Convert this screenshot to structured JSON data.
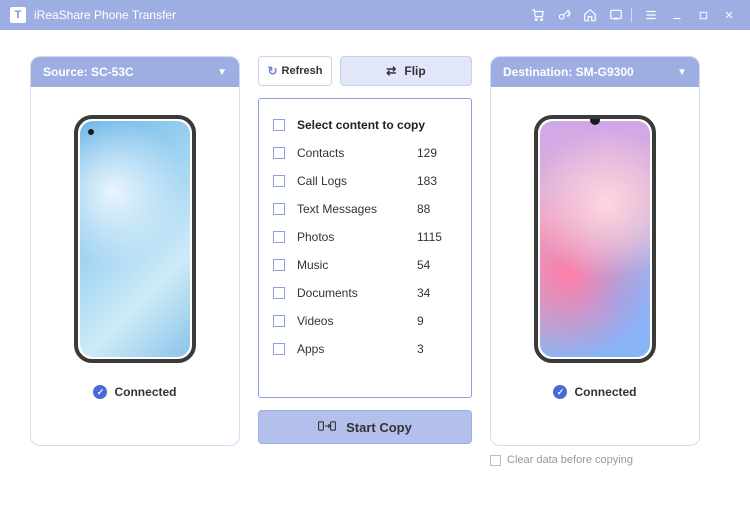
{
  "titlebar": {
    "logo": "T",
    "title": "iReaShare Phone Transfer"
  },
  "source": {
    "header_prefix": "Source: ",
    "device_name": "SC-53C",
    "status": "Connected"
  },
  "destination": {
    "header_prefix": "Destination: ",
    "device_name": "SM-G9300",
    "status": "Connected",
    "clear_label": "Clear data before copying"
  },
  "middle": {
    "refresh_label": "Refresh",
    "flip_label": "Flip",
    "select_all_label": "Select content to copy",
    "start_label": "Start Copy",
    "items": [
      {
        "label": "Contacts",
        "count": "129"
      },
      {
        "label": "Call Logs",
        "count": "183"
      },
      {
        "label": "Text Messages",
        "count": "88"
      },
      {
        "label": "Photos",
        "count": "1115"
      },
      {
        "label": "Music",
        "count": "54"
      },
      {
        "label": "Documents",
        "count": "34"
      },
      {
        "label": "Videos",
        "count": "9"
      },
      {
        "label": "Apps",
        "count": "3"
      }
    ]
  }
}
